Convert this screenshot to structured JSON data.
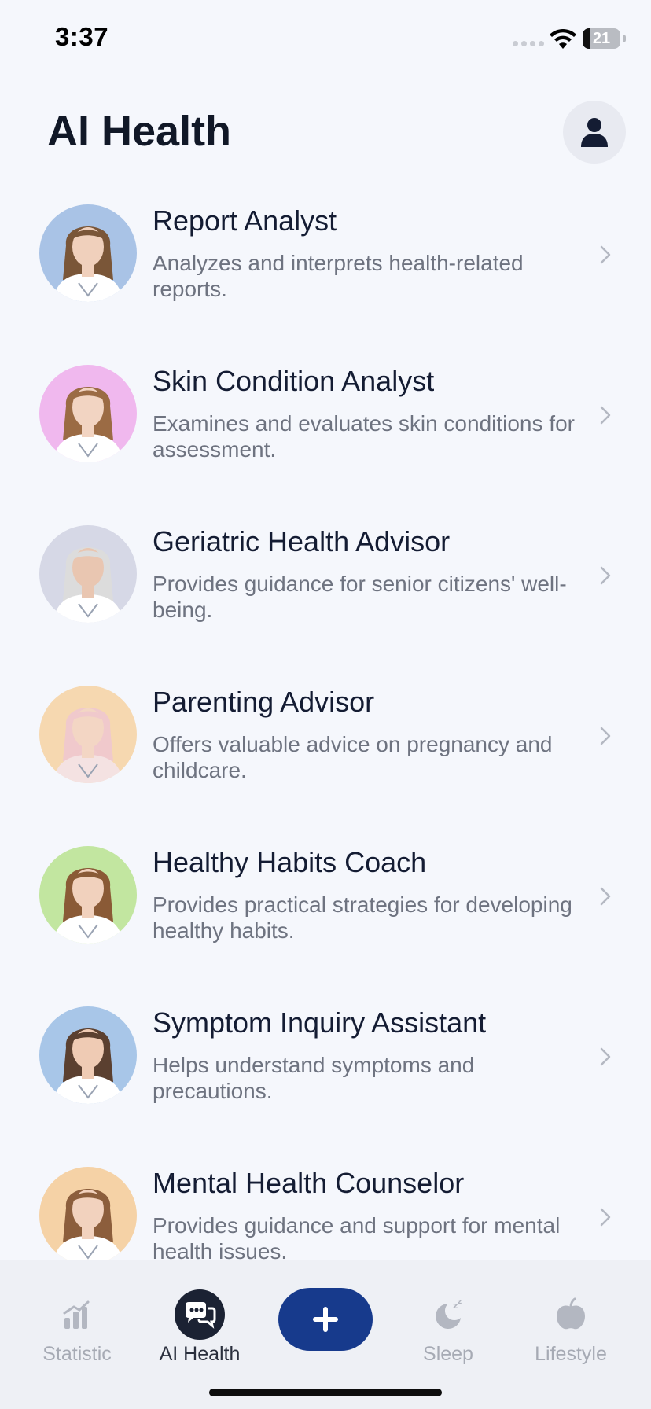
{
  "status_bar": {
    "time": "3:37",
    "battery_level": "21"
  },
  "header": {
    "title": "AI Health",
    "profile_icon": "person-icon"
  },
  "advisors": [
    {
      "name": "Report Analyst",
      "description": "Analyzes and interprets health-related reports.",
      "avatar_bg": "#a9c3e6",
      "hair": "#7a5638",
      "skin": "#f0d0bc",
      "coat": "#ffffff"
    },
    {
      "name": "Skin Condition Analyst",
      "description": "Examines and evaluates skin conditions for assessment.",
      "avatar_bg": "#f0b8ee",
      "hair": "#9b6b44",
      "skin": "#f2d4c2",
      "coat": "#ffffff"
    },
    {
      "name": "Geriatric Health Advisor",
      "description": "Provides guidance for senior citizens' well-being.",
      "avatar_bg": "#d6d8e6",
      "hair": "#dcdcdc",
      "skin": "#e9c6b1",
      "coat": "#ffffff"
    },
    {
      "name": "Parenting Advisor",
      "description": "Offers valuable advice on pregnancy and childcare.",
      "avatar_bg": "#f6d8b0",
      "hair": "#f0c9cc",
      "skin": "#f3d6c4",
      "coat": "#f4e2e2"
    },
    {
      "name": "Healthy Habits Coach",
      "description": "Provides practical strategies for developing healthy habits.",
      "avatar_bg": "#c2e6a0",
      "hair": "#8a5a36",
      "skin": "#f1d1bd",
      "coat": "#ffffff"
    },
    {
      "name": "Symptom Inquiry Assistant",
      "description": "Helps understand symptoms and precautions.",
      "avatar_bg": "#a8c6e8",
      "hair": "#5b4030",
      "skin": "#efcbb4",
      "coat": "#ffffff"
    },
    {
      "name": "Mental Health Counselor",
      "description": "Provides guidance and support for mental health issues.",
      "avatar_bg": "#f5d2a6",
      "hair": "#8c5e3c",
      "skin": "#f2d2be",
      "coat": "#ffffff"
    }
  ],
  "tab_bar": {
    "tabs": [
      {
        "label": "Statistic",
        "icon": "bar-chart-icon"
      },
      {
        "label": "AI Health",
        "icon": "chat-bubbles-icon"
      },
      {
        "label": "Sleep",
        "icon": "moon-zz-icon"
      },
      {
        "label": "Lifestyle",
        "icon": "apple-icon"
      }
    ],
    "active_tab": "AI Health",
    "add_icon": "plus-icon",
    "accent_color": "#173a8c"
  }
}
